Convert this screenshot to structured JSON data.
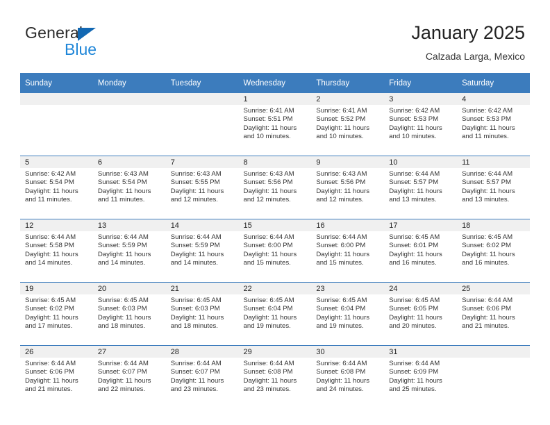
{
  "brand": {
    "name_part1": "General",
    "name_part2": "Blue",
    "triangle_color": "#1268b3",
    "blue_text_color": "#1f86d8"
  },
  "header": {
    "title": "January 2025",
    "subtitle": "Calzada Larga, Mexico"
  },
  "theme": {
    "header_row_bg": "#3c7cbd",
    "day_band_bg": "#f0f0f0",
    "row_divider": "#3c7cbd",
    "page_bg": "#ffffff"
  },
  "weekday_headers": [
    "Sunday",
    "Monday",
    "Tuesday",
    "Wednesday",
    "Thursday",
    "Friday",
    "Saturday"
  ],
  "weeks": [
    [
      {
        "day": "",
        "sunrise": "",
        "sunset": "",
        "daylight_line1": "",
        "daylight_line2": "",
        "empty": true
      },
      {
        "day": "",
        "sunrise": "",
        "sunset": "",
        "daylight_line1": "",
        "daylight_line2": "",
        "empty": true
      },
      {
        "day": "",
        "sunrise": "",
        "sunset": "",
        "daylight_line1": "",
        "daylight_line2": "",
        "empty": true
      },
      {
        "day": "1",
        "sunrise": "Sunrise: 6:41 AM",
        "sunset": "Sunset: 5:51 PM",
        "daylight_line1": "Daylight: 11 hours",
        "daylight_line2": "and 10 minutes.",
        "empty": false
      },
      {
        "day": "2",
        "sunrise": "Sunrise: 6:41 AM",
        "sunset": "Sunset: 5:52 PM",
        "daylight_line1": "Daylight: 11 hours",
        "daylight_line2": "and 10 minutes.",
        "empty": false
      },
      {
        "day": "3",
        "sunrise": "Sunrise: 6:42 AM",
        "sunset": "Sunset: 5:53 PM",
        "daylight_line1": "Daylight: 11 hours",
        "daylight_line2": "and 10 minutes.",
        "empty": false
      },
      {
        "day": "4",
        "sunrise": "Sunrise: 6:42 AM",
        "sunset": "Sunset: 5:53 PM",
        "daylight_line1": "Daylight: 11 hours",
        "daylight_line2": "and 11 minutes.",
        "empty": false
      }
    ],
    [
      {
        "day": "5",
        "sunrise": "Sunrise: 6:42 AM",
        "sunset": "Sunset: 5:54 PM",
        "daylight_line1": "Daylight: 11 hours",
        "daylight_line2": "and 11 minutes.",
        "empty": false
      },
      {
        "day": "6",
        "sunrise": "Sunrise: 6:43 AM",
        "sunset": "Sunset: 5:54 PM",
        "daylight_line1": "Daylight: 11 hours",
        "daylight_line2": "and 11 minutes.",
        "empty": false
      },
      {
        "day": "7",
        "sunrise": "Sunrise: 6:43 AM",
        "sunset": "Sunset: 5:55 PM",
        "daylight_line1": "Daylight: 11 hours",
        "daylight_line2": "and 12 minutes.",
        "empty": false
      },
      {
        "day": "8",
        "sunrise": "Sunrise: 6:43 AM",
        "sunset": "Sunset: 5:56 PM",
        "daylight_line1": "Daylight: 11 hours",
        "daylight_line2": "and 12 minutes.",
        "empty": false
      },
      {
        "day": "9",
        "sunrise": "Sunrise: 6:43 AM",
        "sunset": "Sunset: 5:56 PM",
        "daylight_line1": "Daylight: 11 hours",
        "daylight_line2": "and 12 minutes.",
        "empty": false
      },
      {
        "day": "10",
        "sunrise": "Sunrise: 6:44 AM",
        "sunset": "Sunset: 5:57 PM",
        "daylight_line1": "Daylight: 11 hours",
        "daylight_line2": "and 13 minutes.",
        "empty": false
      },
      {
        "day": "11",
        "sunrise": "Sunrise: 6:44 AM",
        "sunset": "Sunset: 5:57 PM",
        "daylight_line1": "Daylight: 11 hours",
        "daylight_line2": "and 13 minutes.",
        "empty": false
      }
    ],
    [
      {
        "day": "12",
        "sunrise": "Sunrise: 6:44 AM",
        "sunset": "Sunset: 5:58 PM",
        "daylight_line1": "Daylight: 11 hours",
        "daylight_line2": "and 14 minutes.",
        "empty": false
      },
      {
        "day": "13",
        "sunrise": "Sunrise: 6:44 AM",
        "sunset": "Sunset: 5:59 PM",
        "daylight_line1": "Daylight: 11 hours",
        "daylight_line2": "and 14 minutes.",
        "empty": false
      },
      {
        "day": "14",
        "sunrise": "Sunrise: 6:44 AM",
        "sunset": "Sunset: 5:59 PM",
        "daylight_line1": "Daylight: 11 hours",
        "daylight_line2": "and 14 minutes.",
        "empty": false
      },
      {
        "day": "15",
        "sunrise": "Sunrise: 6:44 AM",
        "sunset": "Sunset: 6:00 PM",
        "daylight_line1": "Daylight: 11 hours",
        "daylight_line2": "and 15 minutes.",
        "empty": false
      },
      {
        "day": "16",
        "sunrise": "Sunrise: 6:44 AM",
        "sunset": "Sunset: 6:00 PM",
        "daylight_line1": "Daylight: 11 hours",
        "daylight_line2": "and 15 minutes.",
        "empty": false
      },
      {
        "day": "17",
        "sunrise": "Sunrise: 6:45 AM",
        "sunset": "Sunset: 6:01 PM",
        "daylight_line1": "Daylight: 11 hours",
        "daylight_line2": "and 16 minutes.",
        "empty": false
      },
      {
        "day": "18",
        "sunrise": "Sunrise: 6:45 AM",
        "sunset": "Sunset: 6:02 PM",
        "daylight_line1": "Daylight: 11 hours",
        "daylight_line2": "and 16 minutes.",
        "empty": false
      }
    ],
    [
      {
        "day": "19",
        "sunrise": "Sunrise: 6:45 AM",
        "sunset": "Sunset: 6:02 PM",
        "daylight_line1": "Daylight: 11 hours",
        "daylight_line2": "and 17 minutes.",
        "empty": false
      },
      {
        "day": "20",
        "sunrise": "Sunrise: 6:45 AM",
        "sunset": "Sunset: 6:03 PM",
        "daylight_line1": "Daylight: 11 hours",
        "daylight_line2": "and 18 minutes.",
        "empty": false
      },
      {
        "day": "21",
        "sunrise": "Sunrise: 6:45 AM",
        "sunset": "Sunset: 6:03 PM",
        "daylight_line1": "Daylight: 11 hours",
        "daylight_line2": "and 18 minutes.",
        "empty": false
      },
      {
        "day": "22",
        "sunrise": "Sunrise: 6:45 AM",
        "sunset": "Sunset: 6:04 PM",
        "daylight_line1": "Daylight: 11 hours",
        "daylight_line2": "and 19 minutes.",
        "empty": false
      },
      {
        "day": "23",
        "sunrise": "Sunrise: 6:45 AM",
        "sunset": "Sunset: 6:04 PM",
        "daylight_line1": "Daylight: 11 hours",
        "daylight_line2": "and 19 minutes.",
        "empty": false
      },
      {
        "day": "24",
        "sunrise": "Sunrise: 6:45 AM",
        "sunset": "Sunset: 6:05 PM",
        "daylight_line1": "Daylight: 11 hours",
        "daylight_line2": "and 20 minutes.",
        "empty": false
      },
      {
        "day": "25",
        "sunrise": "Sunrise: 6:44 AM",
        "sunset": "Sunset: 6:06 PM",
        "daylight_line1": "Daylight: 11 hours",
        "daylight_line2": "and 21 minutes.",
        "empty": false
      }
    ],
    [
      {
        "day": "26",
        "sunrise": "Sunrise: 6:44 AM",
        "sunset": "Sunset: 6:06 PM",
        "daylight_line1": "Daylight: 11 hours",
        "daylight_line2": "and 21 minutes.",
        "empty": false
      },
      {
        "day": "27",
        "sunrise": "Sunrise: 6:44 AM",
        "sunset": "Sunset: 6:07 PM",
        "daylight_line1": "Daylight: 11 hours",
        "daylight_line2": "and 22 minutes.",
        "empty": false
      },
      {
        "day": "28",
        "sunrise": "Sunrise: 6:44 AM",
        "sunset": "Sunset: 6:07 PM",
        "daylight_line1": "Daylight: 11 hours",
        "daylight_line2": "and 23 minutes.",
        "empty": false
      },
      {
        "day": "29",
        "sunrise": "Sunrise: 6:44 AM",
        "sunset": "Sunset: 6:08 PM",
        "daylight_line1": "Daylight: 11 hours",
        "daylight_line2": "and 23 minutes.",
        "empty": false
      },
      {
        "day": "30",
        "sunrise": "Sunrise: 6:44 AM",
        "sunset": "Sunset: 6:08 PM",
        "daylight_line1": "Daylight: 11 hours",
        "daylight_line2": "and 24 minutes.",
        "empty": false
      },
      {
        "day": "31",
        "sunrise": "Sunrise: 6:44 AM",
        "sunset": "Sunset: 6:09 PM",
        "daylight_line1": "Daylight: 11 hours",
        "daylight_line2": "and 25 minutes.",
        "empty": false
      },
      {
        "day": "",
        "sunrise": "",
        "sunset": "",
        "daylight_line1": "",
        "daylight_line2": "",
        "empty": true
      }
    ]
  ]
}
